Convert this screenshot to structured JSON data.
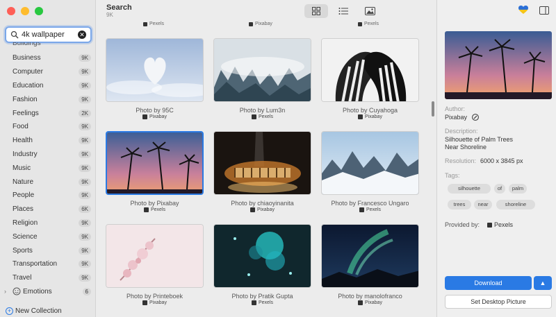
{
  "search": {
    "value": "4k wallpaper"
  },
  "categories": [
    {
      "label": "Business",
      "count": "9K"
    },
    {
      "label": "Computer",
      "count": "9K"
    },
    {
      "label": "Education",
      "count": "9K"
    },
    {
      "label": "Fashion",
      "count": "9K"
    },
    {
      "label": "Feelings",
      "count": "2K"
    },
    {
      "label": "Food",
      "count": "9K"
    },
    {
      "label": "Health",
      "count": "9K"
    },
    {
      "label": "Industry",
      "count": "9K"
    },
    {
      "label": "Music",
      "count": "9K"
    },
    {
      "label": "Nature",
      "count": "9K"
    },
    {
      "label": "People",
      "count": "9K"
    },
    {
      "label": "Places",
      "count": "6K"
    },
    {
      "label": "Religion",
      "count": "9K"
    },
    {
      "label": "Science",
      "count": "9K"
    },
    {
      "label": "Sports",
      "count": "9K"
    },
    {
      "label": "Transportation",
      "count": "9K"
    },
    {
      "label": "Travel",
      "count": "9K"
    }
  ],
  "partial_category": "Buildings",
  "emotions": {
    "label": "Emotions",
    "count": "6"
  },
  "new_collection": "New Collection",
  "main": {
    "title": "Search",
    "subtitle": "9K",
    "top_sources": [
      "Pexels",
      "Pixabay",
      "Pexels"
    ],
    "photos": [
      {
        "caption": "Photo by 95C",
        "source": "Pixabay"
      },
      {
        "caption": "Photo by Lum3n",
        "source": "Pexels"
      },
      {
        "caption": "Photo by Cuyahoga",
        "source": "Pixabay"
      },
      {
        "caption": "Photo by Pixabay",
        "source": "Pexels"
      },
      {
        "caption": "Photo by chiaoyinanita",
        "source": "Pixabay"
      },
      {
        "caption": "Photo by Francesco Ungaro",
        "source": "Pexels"
      },
      {
        "caption": "Photo by Printeboek",
        "source": "Pixabay"
      },
      {
        "caption": "Photo by Pratik Gupta",
        "source": "Pexels"
      },
      {
        "caption": "Photo by manolofranco",
        "source": "Pixabay"
      }
    ]
  },
  "detail": {
    "author_label": "Author:",
    "author": "Pixabay",
    "description_label": "Description:",
    "description_line1": "Silhouette of Palm Trees",
    "description_line2": "Near Shoreline",
    "resolution_label": "Resolution:",
    "resolution": "6000 x 3845 px",
    "tags_label": "Tags:",
    "tags": [
      "silhouette",
      "of",
      "palm",
      "trees",
      "near",
      "shoreline"
    ],
    "provided_label": "Provided by:",
    "provider": "Pexels",
    "download_label": "Download",
    "download_arrow": "▲",
    "desktop_label": "Set Desktop Picture"
  },
  "colors": {
    "accent": "#2a7ae4"
  }
}
